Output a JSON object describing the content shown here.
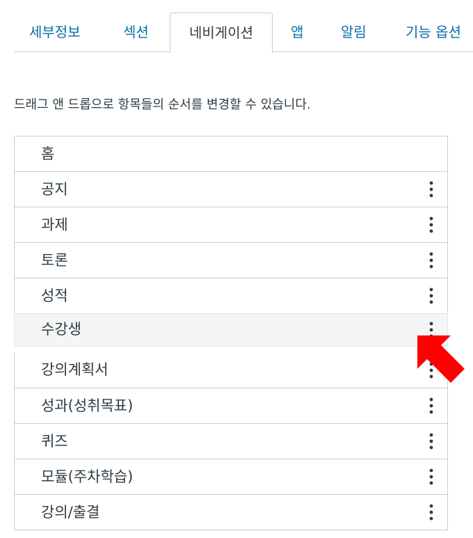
{
  "tabs": [
    {
      "label": "세부정보",
      "active": false
    },
    {
      "label": "섹션",
      "active": false
    },
    {
      "label": "네비게이션",
      "active": true
    },
    {
      "label": "앱",
      "active": false
    },
    {
      "label": "알림",
      "active": false
    },
    {
      "label": "기능 옵션",
      "active": false
    }
  ],
  "instructions": "드래그 앤 드롭으로 항목들의 순서를 변경할 수 있습니다.",
  "nav_items": [
    {
      "label": "홈",
      "has_menu": false
    },
    {
      "label": "공지",
      "has_menu": true
    },
    {
      "label": "과제",
      "has_menu": true
    },
    {
      "label": "토론",
      "has_menu": true
    },
    {
      "label": "성적",
      "has_menu": true
    },
    {
      "label": "수강생",
      "has_menu": true,
      "state": "dragging"
    },
    {
      "label": "강의계획서",
      "has_menu": true
    },
    {
      "label": "성과(성취목표)",
      "has_menu": true
    },
    {
      "label": "퀴즈",
      "has_menu": true
    },
    {
      "label": "모듈(주차학습)",
      "has_menu": true
    },
    {
      "label": "강의/출결",
      "has_menu": true
    }
  ],
  "annotation": {
    "icon": "arrow-pointer-icon",
    "color": "#ff0000"
  },
  "colors": {
    "link": "#0770a3",
    "text": "#2d3b45",
    "border": "#c7cdd1"
  }
}
